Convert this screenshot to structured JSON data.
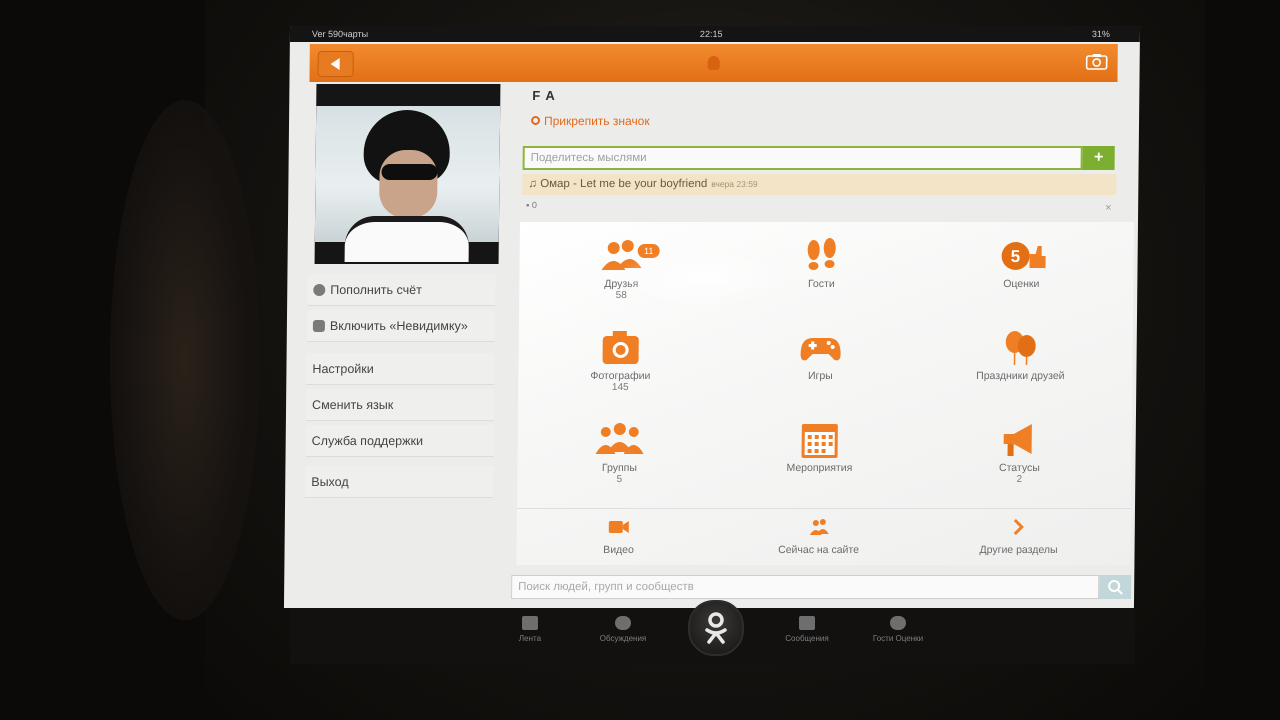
{
  "status_bar": {
    "carrier": "Ver 590чарты",
    "time": "22:15",
    "battery": "31%"
  },
  "profile": {
    "name": "F A",
    "pin_label": "Прикрепить значок"
  },
  "left_menu": [
    {
      "label": "Пополнить счёт",
      "icon": "coin-icon"
    },
    {
      "label": "Включить «Невидимку»",
      "icon": "hat-icon"
    },
    {
      "label": "Настройки"
    },
    {
      "label": "Сменить язык"
    },
    {
      "label": "Служба поддержки"
    },
    {
      "label": "Выход"
    }
  ],
  "share": {
    "placeholder": "Поделитесь мыслями",
    "plus": "+"
  },
  "music_status": {
    "text": "Омар - Let me be your boyfriend",
    "when": "вчера 23:59"
  },
  "comments_count": "0",
  "close_symbol": "×",
  "sections": [
    {
      "label": "Друзья",
      "count": "58",
      "badge": "11",
      "icon": "friends-icon"
    },
    {
      "label": "Гости",
      "count": "",
      "icon": "footprints-icon"
    },
    {
      "label": "Оценки",
      "count": "",
      "icon": "five-plus-icon"
    },
    {
      "label": "Фотографии",
      "count": "145",
      "icon": "camera-icon"
    },
    {
      "label": "Игры",
      "count": "",
      "icon": "gamepad-icon"
    },
    {
      "label": "Праздники друзей",
      "count": "",
      "icon": "balloons-icon"
    },
    {
      "label": "Группы",
      "count": "5",
      "icon": "groups-icon"
    },
    {
      "label": "Мероприятия",
      "count": "",
      "icon": "calendar-icon"
    },
    {
      "label": "Статусы",
      "count": "2",
      "icon": "megaphone-icon"
    }
  ],
  "small_sections": [
    {
      "label": "Видео",
      "icon": "video-icon"
    },
    {
      "label": "Сейчас на сайте",
      "icon": "online-icon"
    },
    {
      "label": "Другие разделы",
      "icon": "chevron-right-icon"
    }
  ],
  "search": {
    "placeholder": "Поиск людей, групп и сообществ"
  },
  "tabbar": [
    {
      "label": "Лента",
      "icon": "feed-icon"
    },
    {
      "label": "Обсуждения",
      "icon": "discussions-icon"
    },
    {
      "label": "Сообщения",
      "icon": "messages-icon"
    },
    {
      "label": "Гости Оценки",
      "icon": "guests-ratings-icon"
    }
  ],
  "colors": {
    "accent": "#e36f15",
    "green": "#7dae2f",
    "icon_orange": "#f07e25"
  }
}
